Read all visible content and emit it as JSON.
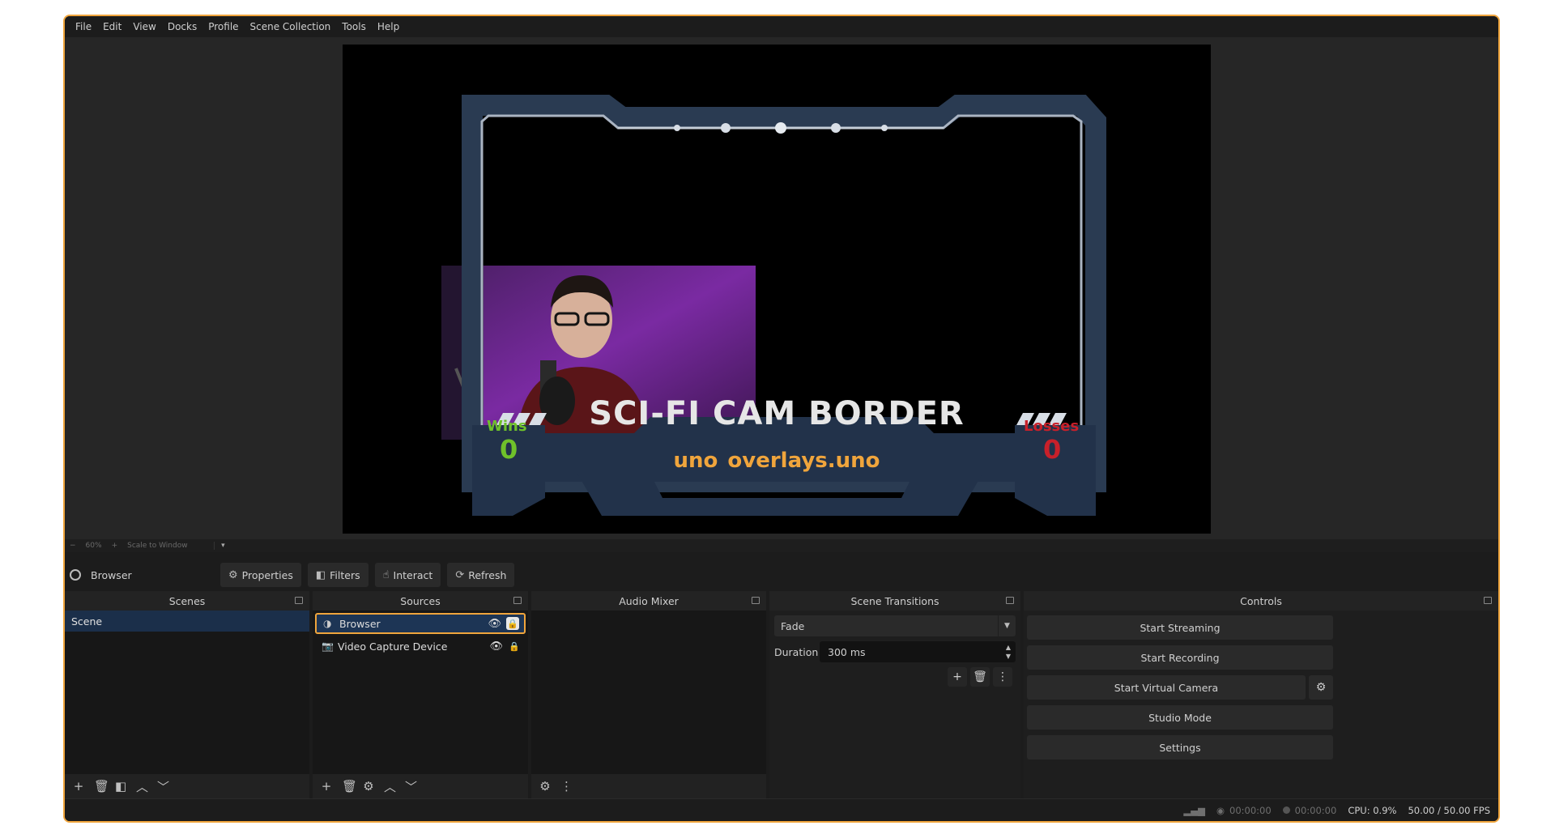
{
  "menu": [
    "File",
    "Edit",
    "View",
    "Docks",
    "Profile",
    "Scene Collection",
    "Tools",
    "Help"
  ],
  "preview": {
    "overlay_title": "SCI-FI CAM BORDER",
    "wins_label": "Wins",
    "wins_value": "0",
    "losses_label": "Losses",
    "losses_value": "0",
    "brand_logo": "uno",
    "brand_text": "overlays.uno",
    "colors": {
      "wins": "#6fc12a",
      "losses": "#c8202a",
      "brand": "#f0a53c"
    }
  },
  "zoom": {
    "minus": "−",
    "level": "60%",
    "plus": "+",
    "mode": "Scale to Window"
  },
  "source_toolbar": {
    "selected_source": "Browser",
    "properties": "Properties",
    "filters": "Filters",
    "interact": "Interact",
    "refresh": "Refresh"
  },
  "docks": {
    "scenes": {
      "title": "Scenes",
      "items": [
        "Scene"
      ]
    },
    "sources": {
      "title": "Sources",
      "items": [
        {
          "name": "Browser",
          "icon": "browser-icon"
        },
        {
          "name": "Video Capture Device",
          "icon": "camera-icon"
        }
      ]
    },
    "audio_mixer": {
      "title": "Audio Mixer"
    },
    "transitions": {
      "title": "Scene Transitions",
      "selected": "Fade",
      "duration_label": "Duration",
      "duration_value": "300 ms"
    },
    "controls": {
      "title": "Controls",
      "start_streaming": "Start Streaming",
      "start_recording": "Start Recording",
      "start_virtual_camera": "Start Virtual Camera",
      "studio_mode": "Studio Mode",
      "settings": "Settings"
    }
  },
  "status": {
    "stream_time": "00:00:00",
    "record_time": "00:00:00",
    "cpu": "CPU: 0.9%",
    "fps": "50.00 / 50.00 FPS"
  }
}
